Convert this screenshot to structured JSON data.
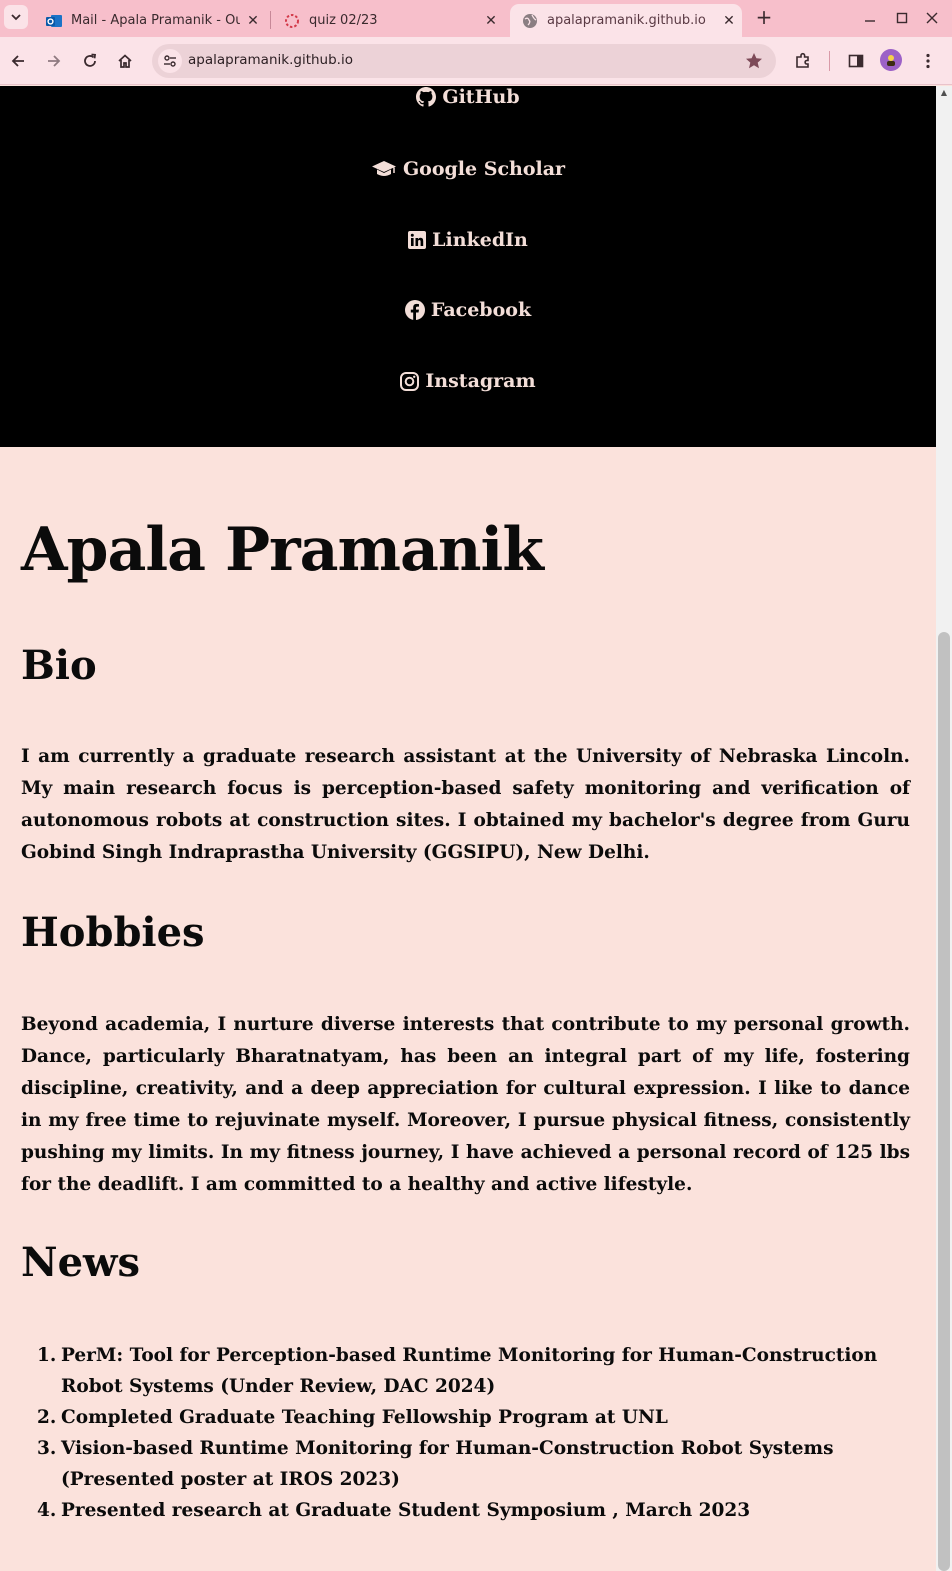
{
  "browser": {
    "tabs": [
      {
        "title": "Mail - Apala Pramanik - Ou",
        "favicon": "outlook-icon"
      },
      {
        "title": "quiz 02/23",
        "favicon": "loading-spinner-icon"
      },
      {
        "title": "apalapramanik.github.io",
        "favicon": "globe-icon",
        "active": true
      }
    ],
    "new_tab_label": "+",
    "address": "apalapramanik.github.io"
  },
  "social": {
    "github": "GitHub",
    "scholar": "Google Scholar",
    "linkedin": "LinkedIn",
    "facebook": "Facebook",
    "instagram": "Instagram"
  },
  "profile": {
    "name": "Apala Pramanik",
    "bio_heading": "Bio",
    "bio_text": "I am currently a graduate research assistant at the University of Nebraska Lincoln. My main research focus is perception-based safety monitoring and verification of autonomous robots at construction sites. I obtained my bachelor's degree from Guru Gobind Singh Indraprastha University (GGSIPU), New Delhi.",
    "hobbies_heading": "Hobbies",
    "hobbies_text": "Beyond academia, I nurture diverse interests that contribute to my personal growth. Dance, particularly Bharatnatyam, has been an integral part of my life, fostering discipline, creativity, and a deep appreciation for cultural expression. I like to dance in my free time to rejuvinate myself. Moreover, I pursue physical fitness, consistently pushing my limits. In my fitness journey, I have achieved a personal record of 125 lbs for the deadlift. I am committed to a healthy and active lifestyle.",
    "news_heading": "News",
    "news": [
      {
        "num": "1.",
        "text": "PerM: Tool for Perception-based Runtime Monitoring for Human-Construction Robot Systems (Under Review, DAC 2024)"
      },
      {
        "num": "2.",
        "text": "Completed Graduate Teaching Fellowship Program at UNL"
      },
      {
        "num": "3.",
        "text": "Vision-based Runtime Monitoring for Human-Construction Robot Systems (Presented poster at IROS 2023)"
      },
      {
        "num": "4.",
        "text": "Presented research at Graduate Student Symposium , March 2023"
      }
    ]
  },
  "colors": {
    "page_background": "#fbe2dc",
    "social_band": "#000000",
    "social_text": "#f3ded8",
    "tabstrip": "#f7bfcb"
  }
}
